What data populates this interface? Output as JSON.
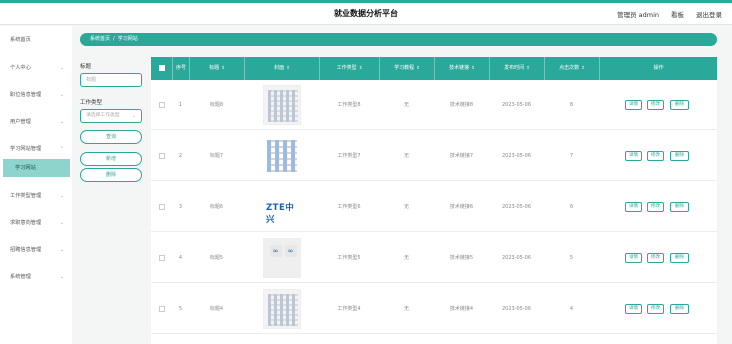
{
  "app": {
    "title": "就业数据分析平台",
    "user": "管理员 admin",
    "nav_front": "看板",
    "logout": "退出登录"
  },
  "sidebar": {
    "items": [
      {
        "label": "系统首页",
        "has_chevron": false
      },
      {
        "label": "个人中心",
        "has_chevron": true
      },
      {
        "label": "职位信息管理",
        "has_chevron": true
      },
      {
        "label": "用户管理",
        "has_chevron": true
      },
      {
        "label": "学习网站管理",
        "has_chevron": true
      },
      {
        "label": "工作类型管理",
        "has_chevron": true
      },
      {
        "label": "求职意向管理",
        "has_chevron": true
      },
      {
        "label": "招聘信息管理",
        "has_chevron": true
      },
      {
        "label": "系统管理",
        "has_chevron": true
      }
    ],
    "active_sub": "学习网站"
  },
  "breadcrumb": {
    "home": "系统首页",
    "separator": "/",
    "current": "学习网站"
  },
  "filters": {
    "title_label": "标题",
    "title_placeholder": "标题",
    "type_label": "工作类型",
    "type_placeholder": "请选择工作类型",
    "query_button": "查询",
    "add_button": "新增",
    "delete_button": "删除"
  },
  "table": {
    "headers": {
      "index": "序号",
      "title": "标题",
      "cover": "封面",
      "work_type": "工作类型",
      "tutorial": "学习教程",
      "tech_link": "技术链接",
      "publish_time": "发布时间",
      "clicks": "点击次数",
      "actions": "操作"
    },
    "action_labels": {
      "detail": "详情",
      "edit": "修改",
      "delete": "删除"
    },
    "rows": [
      {
        "index": "1",
        "title": "标题8",
        "cover": "screenshot",
        "work_type": "工作类型8",
        "tutorial": "无",
        "tech_link": "技术链接8",
        "publish_time": "2023-05-06",
        "clicks": "8"
      },
      {
        "index": "2",
        "title": "标题7",
        "cover": "logo-grid",
        "work_type": "工作类型7",
        "tutorial": "无",
        "tech_link": "技术链接7",
        "publish_time": "2023-05-06",
        "clicks": "7"
      },
      {
        "index": "3",
        "title": "标题6",
        "cover": "zte",
        "zte_text": "ZTE中兴",
        "work_type": "工作类型6",
        "tutorial": "无",
        "tech_link": "技术链接6",
        "publish_time": "2023-05-06",
        "clicks": "6"
      },
      {
        "index": "4",
        "title": "标题5",
        "cover": "logo-pair",
        "work_type": "工作类型5",
        "tutorial": "无",
        "tech_link": "技术链接5",
        "publish_time": "2023-05-06",
        "clicks": "5"
      },
      {
        "index": "5",
        "title": "标题4",
        "cover": "screenshot",
        "work_type": "工作类型4",
        "tutorial": "无",
        "tech_link": "技术链接4",
        "publish_time": "2023-05-06",
        "clicks": "4"
      }
    ]
  },
  "colors": {
    "accent": "#2aa89a",
    "active_sub_bg": "#8ed3cc"
  }
}
